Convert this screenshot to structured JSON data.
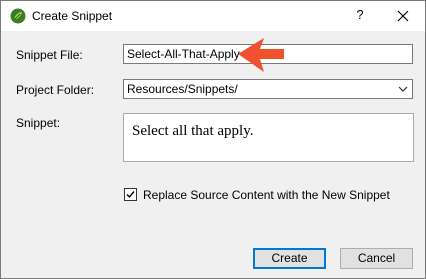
{
  "window": {
    "title": "Create Snippet",
    "help_label": "?",
    "app_icon": "leaf-logo-icon",
    "close_icon": "close-icon"
  },
  "form": {
    "snippet_file_label": "Snippet File:",
    "snippet_file_value": "Select-All-That-Apply",
    "project_folder_label": "Project Folder:",
    "project_folder_value": "Resources/Snippets/",
    "snippet_label": "Snippet:",
    "snippet_content": "Select all that apply.",
    "replace_checkbox_label": "Replace Source Content with the New Snippet",
    "replace_checked": true
  },
  "buttons": {
    "create": "Create",
    "cancel": "Cancel"
  },
  "annotation": {
    "arrow_icon": "orange-callout-arrow-icon",
    "arrow_color": "#f0522f"
  }
}
